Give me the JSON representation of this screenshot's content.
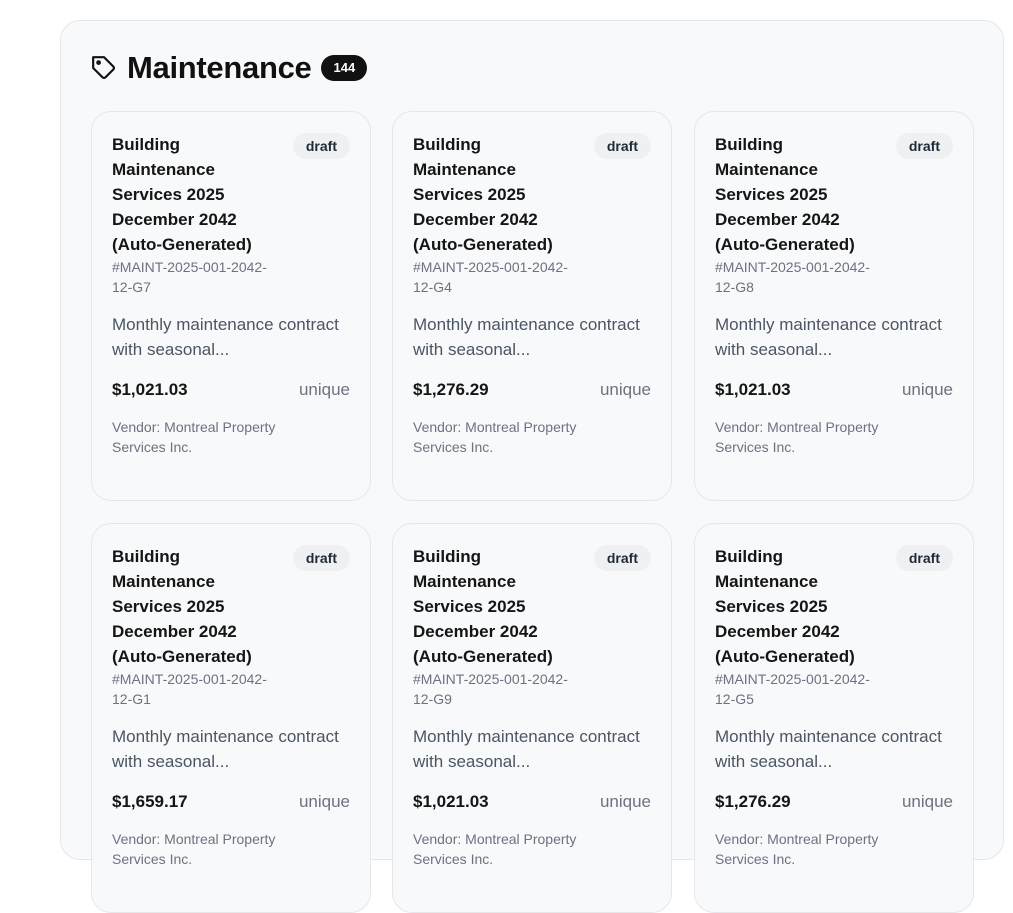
{
  "section": {
    "title": "Maintenance",
    "count": "144",
    "icon": "tag-icon"
  },
  "cards": [
    {
      "title": "Building Maintenance Services 2025 December 2042 (Auto-Generated)",
      "status": "draft",
      "code": "#MAINT-2025-001-2042-12-G7",
      "description": "Monthly maintenance contract with seasonal...",
      "price": "$1,021.03",
      "type": "unique",
      "vendor": "Vendor: Montreal Property Services Inc."
    },
    {
      "title": "Building Maintenance Services 2025 December 2042 (Auto-Generated)",
      "status": "draft",
      "code": "#MAINT-2025-001-2042-12-G4",
      "description": "Monthly maintenance contract with seasonal...",
      "price": "$1,276.29",
      "type": "unique",
      "vendor": "Vendor: Montreal Property Services Inc."
    },
    {
      "title": "Building Maintenance Services 2025 December 2042 (Auto-Generated)",
      "status": "draft",
      "code": "#MAINT-2025-001-2042-12-G8",
      "description": "Monthly maintenance contract with seasonal...",
      "price": "$1,021.03",
      "type": "unique",
      "vendor": "Vendor: Montreal Property Services Inc."
    },
    {
      "title": "Building Maintenance Services 2025 December 2042 (Auto-Generated)",
      "status": "draft",
      "code": "#MAINT-2025-001-2042-12-G1",
      "description": "Monthly maintenance contract with seasonal...",
      "price": "$1,659.17",
      "type": "unique",
      "vendor": "Vendor: Montreal Property Services Inc."
    },
    {
      "title": "Building Maintenance Services 2025 December 2042 (Auto-Generated)",
      "status": "draft",
      "code": "#MAINT-2025-001-2042-12-G9",
      "description": "Monthly maintenance contract with seasonal...",
      "price": "$1,021.03",
      "type": "unique",
      "vendor": "Vendor: Montreal Property Services Inc."
    },
    {
      "title": "Building Maintenance Services 2025 December 2042 (Auto-Generated)",
      "status": "draft",
      "code": "#MAINT-2025-001-2042-12-G5",
      "description": "Monthly maintenance contract with seasonal...",
      "price": "$1,276.29",
      "type": "unique",
      "vendor": "Vendor: Montreal Property Services Inc."
    }
  ]
}
